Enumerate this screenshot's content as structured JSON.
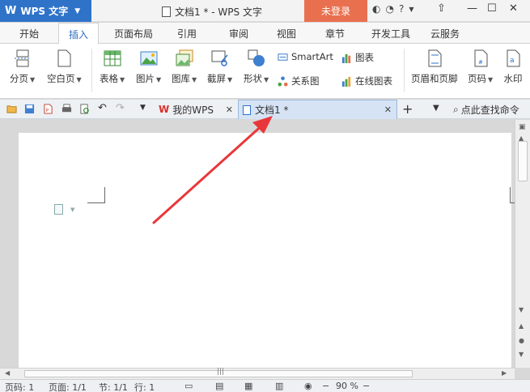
{
  "titlebar": {
    "app_name": "WPS 文字",
    "window_title": "文档1 * - WPS 文字",
    "login_label": "未登录"
  },
  "ribbon_tabs": [
    "开始",
    "插入",
    "页面布局",
    "引用",
    "审阅",
    "视图",
    "章节",
    "开发工具",
    "云服务"
  ],
  "active_tab_index": 1,
  "ribbon": {
    "page_break": "分页",
    "blank_page": "空白页",
    "table": "表格",
    "picture": "图片",
    "gallery": "图库",
    "screenshot": "截屏",
    "shape": "形状",
    "smartart": "SmartArt",
    "chart": "图表",
    "relation_chart": "关系图",
    "online_chart": "在线图表",
    "header_footer": "页眉和页脚",
    "page_number": "页码",
    "watermark": "水印"
  },
  "doc_tabs": {
    "my_wps": "我的WPS",
    "doc1": "文档1 *"
  },
  "search": {
    "label": "点此查找命令"
  },
  "status": {
    "page_num": "页码: 1",
    "pages": "页面: 1/1",
    "section": "节: 1/1",
    "row": "行: 1",
    "zoom": "90 %"
  },
  "colors": {
    "app_blue": "#2f73c9",
    "login_orange": "#e9704f",
    "tab_active_text": "#2e6dc2",
    "arrow_red": "#e8373b"
  }
}
